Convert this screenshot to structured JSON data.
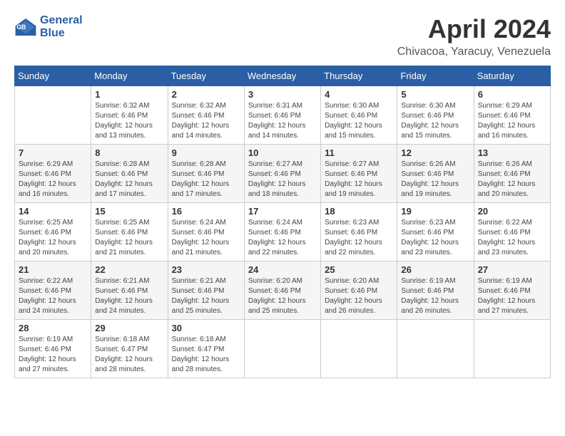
{
  "header": {
    "logo_line1": "General",
    "logo_line2": "Blue",
    "month_title": "April 2024",
    "location": "Chivacoa, Yaracuy, Venezuela"
  },
  "days_of_week": [
    "Sunday",
    "Monday",
    "Tuesday",
    "Wednesday",
    "Thursday",
    "Friday",
    "Saturday"
  ],
  "weeks": [
    [
      {
        "day": "",
        "sunrise": "",
        "sunset": "",
        "daylight": ""
      },
      {
        "day": "1",
        "sunrise": "Sunrise: 6:32 AM",
        "sunset": "Sunset: 6:46 PM",
        "daylight": "Daylight: 12 hours and 13 minutes."
      },
      {
        "day": "2",
        "sunrise": "Sunrise: 6:32 AM",
        "sunset": "Sunset: 6:46 PM",
        "daylight": "Daylight: 12 hours and 14 minutes."
      },
      {
        "day": "3",
        "sunrise": "Sunrise: 6:31 AM",
        "sunset": "Sunset: 6:46 PM",
        "daylight": "Daylight: 12 hours and 14 minutes."
      },
      {
        "day": "4",
        "sunrise": "Sunrise: 6:30 AM",
        "sunset": "Sunset: 6:46 PM",
        "daylight": "Daylight: 12 hours and 15 minutes."
      },
      {
        "day": "5",
        "sunrise": "Sunrise: 6:30 AM",
        "sunset": "Sunset: 6:46 PM",
        "daylight": "Daylight: 12 hours and 15 minutes."
      },
      {
        "day": "6",
        "sunrise": "Sunrise: 6:29 AM",
        "sunset": "Sunset: 6:46 PM",
        "daylight": "Daylight: 12 hours and 16 minutes."
      }
    ],
    [
      {
        "day": "7",
        "sunrise": "Sunrise: 6:29 AM",
        "sunset": "Sunset: 6:46 PM",
        "daylight": "Daylight: 12 hours and 16 minutes."
      },
      {
        "day": "8",
        "sunrise": "Sunrise: 6:28 AM",
        "sunset": "Sunset: 6:46 PM",
        "daylight": "Daylight: 12 hours and 17 minutes."
      },
      {
        "day": "9",
        "sunrise": "Sunrise: 6:28 AM",
        "sunset": "Sunset: 6:46 PM",
        "daylight": "Daylight: 12 hours and 17 minutes."
      },
      {
        "day": "10",
        "sunrise": "Sunrise: 6:27 AM",
        "sunset": "Sunset: 6:46 PM",
        "daylight": "Daylight: 12 hours and 18 minutes."
      },
      {
        "day": "11",
        "sunrise": "Sunrise: 6:27 AM",
        "sunset": "Sunset: 6:46 PM",
        "daylight": "Daylight: 12 hours and 19 minutes."
      },
      {
        "day": "12",
        "sunrise": "Sunrise: 6:26 AM",
        "sunset": "Sunset: 6:46 PM",
        "daylight": "Daylight: 12 hours and 19 minutes."
      },
      {
        "day": "13",
        "sunrise": "Sunrise: 6:26 AM",
        "sunset": "Sunset: 6:46 PM",
        "daylight": "Daylight: 12 hours and 20 minutes."
      }
    ],
    [
      {
        "day": "14",
        "sunrise": "Sunrise: 6:25 AM",
        "sunset": "Sunset: 6:46 PM",
        "daylight": "Daylight: 12 hours and 20 minutes."
      },
      {
        "day": "15",
        "sunrise": "Sunrise: 6:25 AM",
        "sunset": "Sunset: 6:46 PM",
        "daylight": "Daylight: 12 hours and 21 minutes."
      },
      {
        "day": "16",
        "sunrise": "Sunrise: 6:24 AM",
        "sunset": "Sunset: 6:46 PM",
        "daylight": "Daylight: 12 hours and 21 minutes."
      },
      {
        "day": "17",
        "sunrise": "Sunrise: 6:24 AM",
        "sunset": "Sunset: 6:46 PM",
        "daylight": "Daylight: 12 hours and 22 minutes."
      },
      {
        "day": "18",
        "sunrise": "Sunrise: 6:23 AM",
        "sunset": "Sunset: 6:46 PM",
        "daylight": "Daylight: 12 hours and 22 minutes."
      },
      {
        "day": "19",
        "sunrise": "Sunrise: 6:23 AM",
        "sunset": "Sunset: 6:46 PM",
        "daylight": "Daylight: 12 hours and 23 minutes."
      },
      {
        "day": "20",
        "sunrise": "Sunrise: 6:22 AM",
        "sunset": "Sunset: 6:46 PM",
        "daylight": "Daylight: 12 hours and 23 minutes."
      }
    ],
    [
      {
        "day": "21",
        "sunrise": "Sunrise: 6:22 AM",
        "sunset": "Sunset: 6:46 PM",
        "daylight": "Daylight: 12 hours and 24 minutes."
      },
      {
        "day": "22",
        "sunrise": "Sunrise: 6:21 AM",
        "sunset": "Sunset: 6:46 PM",
        "daylight": "Daylight: 12 hours and 24 minutes."
      },
      {
        "day": "23",
        "sunrise": "Sunrise: 6:21 AM",
        "sunset": "Sunset: 6:46 PM",
        "daylight": "Daylight: 12 hours and 25 minutes."
      },
      {
        "day": "24",
        "sunrise": "Sunrise: 6:20 AM",
        "sunset": "Sunset: 6:46 PM",
        "daylight": "Daylight: 12 hours and 25 minutes."
      },
      {
        "day": "25",
        "sunrise": "Sunrise: 6:20 AM",
        "sunset": "Sunset: 6:46 PM",
        "daylight": "Daylight: 12 hours and 26 minutes."
      },
      {
        "day": "26",
        "sunrise": "Sunrise: 6:19 AM",
        "sunset": "Sunset: 6:46 PM",
        "daylight": "Daylight: 12 hours and 26 minutes."
      },
      {
        "day": "27",
        "sunrise": "Sunrise: 6:19 AM",
        "sunset": "Sunset: 6:46 PM",
        "daylight": "Daylight: 12 hours and 27 minutes."
      }
    ],
    [
      {
        "day": "28",
        "sunrise": "Sunrise: 6:19 AM",
        "sunset": "Sunset: 6:46 PM",
        "daylight": "Daylight: 12 hours and 27 minutes."
      },
      {
        "day": "29",
        "sunrise": "Sunrise: 6:18 AM",
        "sunset": "Sunset: 6:47 PM",
        "daylight": "Daylight: 12 hours and 28 minutes."
      },
      {
        "day": "30",
        "sunrise": "Sunrise: 6:18 AM",
        "sunset": "Sunset: 6:47 PM",
        "daylight": "Daylight: 12 hours and 28 minutes."
      },
      {
        "day": "",
        "sunrise": "",
        "sunset": "",
        "daylight": ""
      },
      {
        "day": "",
        "sunrise": "",
        "sunset": "",
        "daylight": ""
      },
      {
        "day": "",
        "sunrise": "",
        "sunset": "",
        "daylight": ""
      },
      {
        "day": "",
        "sunrise": "",
        "sunset": "",
        "daylight": ""
      }
    ]
  ]
}
